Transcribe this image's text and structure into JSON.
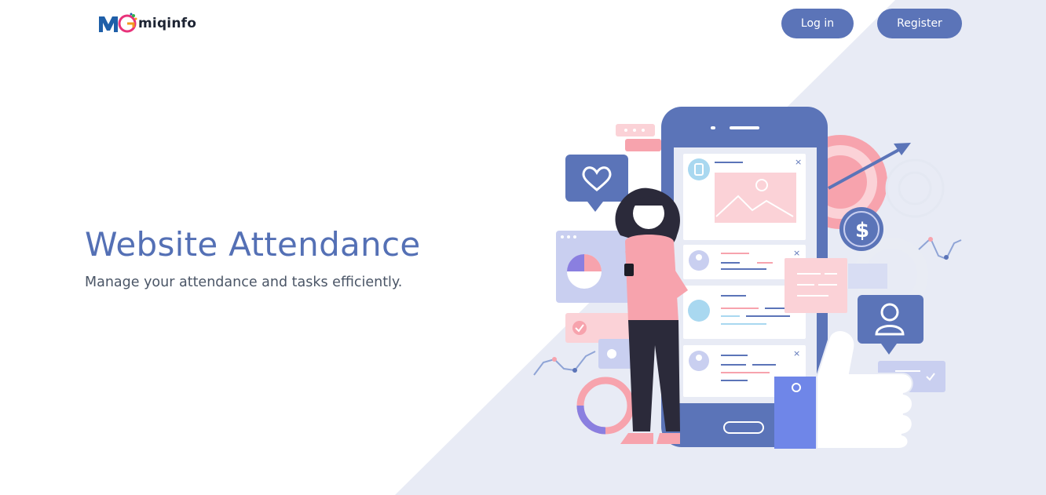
{
  "header": {
    "logo_text": "miqinfo",
    "login_label": "Log in",
    "register_label": "Register"
  },
  "hero": {
    "title": "Website Attendance",
    "subtitle": "Manage your attendance and tasks efficiently."
  },
  "colors": {
    "primary": "#5b74b8",
    "title": "#5470b5",
    "background_tint": "#e8ebf5",
    "accent_pink": "#f7a3ad"
  },
  "illustration": {
    "icons": [
      "heart-icon",
      "dollar-icon",
      "user-icon",
      "target-icon",
      "gear-icon",
      "thumbs-up-icon",
      "shopping-bag-icon",
      "check-icon"
    ]
  }
}
